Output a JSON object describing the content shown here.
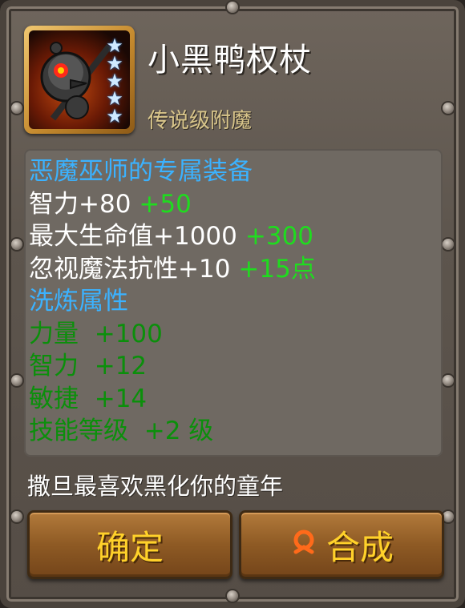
{
  "item": {
    "name": "小黑鸭权杖",
    "rarity": "传说级附魔",
    "star_count": 5,
    "icon": "black-duck-scepter-icon"
  },
  "stats": {
    "exclusive_label": "恶魔巫师的专属装备",
    "base": [
      {
        "label": "智力+80",
        "bonus": "+50"
      },
      {
        "label": "最大生命值+1000",
        "bonus": "+300"
      },
      {
        "label": "忽视魔法抗性+10",
        "bonus": "+15点"
      }
    ],
    "refine_title": "洗炼属性",
    "refine": [
      {
        "label": "力量",
        "value": "+100"
      },
      {
        "label": "智力",
        "value": "+12"
      },
      {
        "label": "敏捷",
        "value": "+14"
      },
      {
        "label": "技能等级",
        "value": "+2 级"
      }
    ]
  },
  "flavor_text": "撒旦最喜欢黑化你的童年",
  "buttons": {
    "confirm": "确定",
    "combine": "合成"
  },
  "colors": {
    "title_blue": "#3bb2ff",
    "bonus_green": "#1fdc1f",
    "refine_green": "#0b8f0b",
    "button_text": "#ffd12a"
  }
}
